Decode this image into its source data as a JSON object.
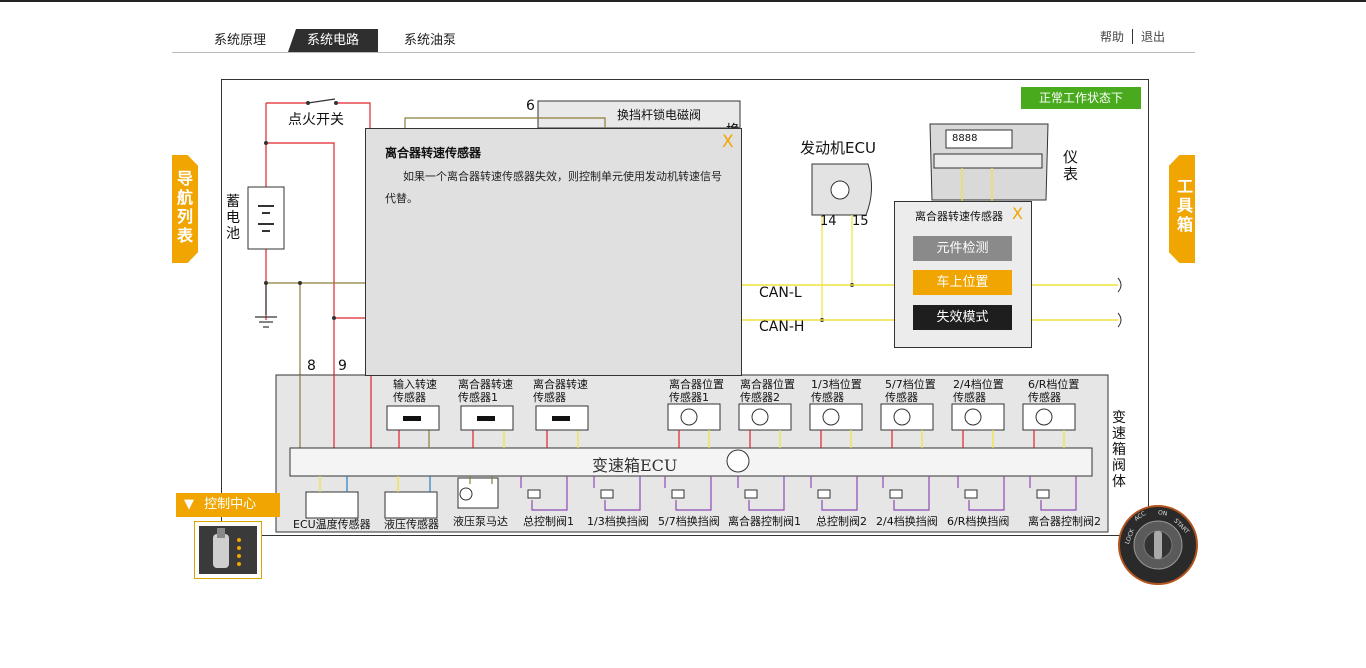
{
  "nav": {
    "tabs": [
      "系统原理",
      "系统电路",
      "系统油泵"
    ],
    "active_tab": "系统电路",
    "help": "帮助",
    "logout": "退出"
  },
  "side": {
    "left": "导航列表",
    "right": "工具箱"
  },
  "status_badge": "正常工作状态下",
  "popup": {
    "title": "离合器转速传感器",
    "body": "如果一个离合器转速传感器失效，则控制单元使用发动机转速信号代替。",
    "close": "X"
  },
  "minipop": {
    "title": "离合器转速传感器",
    "close": "X",
    "buttons": [
      {
        "label": "元件检测",
        "color": "#8a8a8a"
      },
      {
        "label": "车上位置",
        "color": "#f0a500"
      },
      {
        "label": "失效模式",
        "color": "#1e1e1e"
      }
    ]
  },
  "diagram": {
    "ignition": "点火开关",
    "battery": "蓄电池",
    "pin6": "6",
    "shift_lock": "换挡杆锁电磁阀",
    "shift_lock_side": "换",
    "engine_ecu": "发动机ECU",
    "lcd": "8888",
    "pin14": "14",
    "pin15": "15",
    "instrument": "仪表",
    "can_l": "CAN-L",
    "can_h": "CAN-H",
    "pin8": "8",
    "pin9": "9",
    "valve_body": "变速箱阀体",
    "tcu": "变速箱ECU",
    "top_modules": [
      "输入转速传感器",
      "离合器转速传感器1",
      "离合器转速传感器",
      "离合器位置传感器1",
      "离合器位置传感器2",
      "1/3档位置传感器",
      "5/7档位置传感器",
      "2/4档位置传感器",
      "6/R档位置传感器"
    ],
    "bottom_modules": [
      "ECU温度传感器",
      "液压传感器",
      "液压泵马达",
      "总控制阀1",
      "1/3档换挡阀",
      "5/7档换挡阀",
      "离合器控制阀1",
      "总控制阀2",
      "2/4档换挡阀",
      "6/R档换挡阀",
      "离合器控制阀2"
    ]
  },
  "control_center": "控制中心",
  "key_labels": [
    "LOCK",
    "ACC",
    "ON",
    "START"
  ],
  "colors": {
    "accent": "#f0a500",
    "status": "#4aaa1e",
    "wire_red": "#e0222c",
    "wire_yellow": "#f2e23a",
    "wire_olive": "#8e7d3a",
    "wire_purple": "#8d4bb5",
    "wire_blue": "#2a7fc2"
  }
}
